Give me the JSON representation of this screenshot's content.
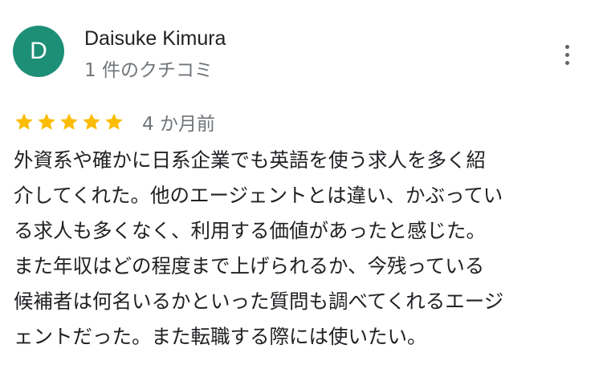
{
  "review": {
    "avatar_initial": "D",
    "avatar_color": "#1e8f77",
    "reviewer_name": "Daisuke Kimura",
    "review_count": "1 件のクチコミ",
    "rating": 5,
    "star_color": "#fbbc04",
    "date": "4 か月前",
    "text_lines": [
      "外資系や確かに日系企業でも英語を使う求人を多く紹",
      "介してくれた。他のエージェントとは違い、かぶってい",
      "る求人も多くなく、利用する価値があったと感じた。",
      "また年収はどの程度まで上げられるか、今残っている",
      "候補者は何名いるかといった質問も調べてくれるエージ",
      "ェントだった。また転職する際には使いたい。"
    ]
  },
  "menu": {
    "icon": "more-vert-icon"
  }
}
